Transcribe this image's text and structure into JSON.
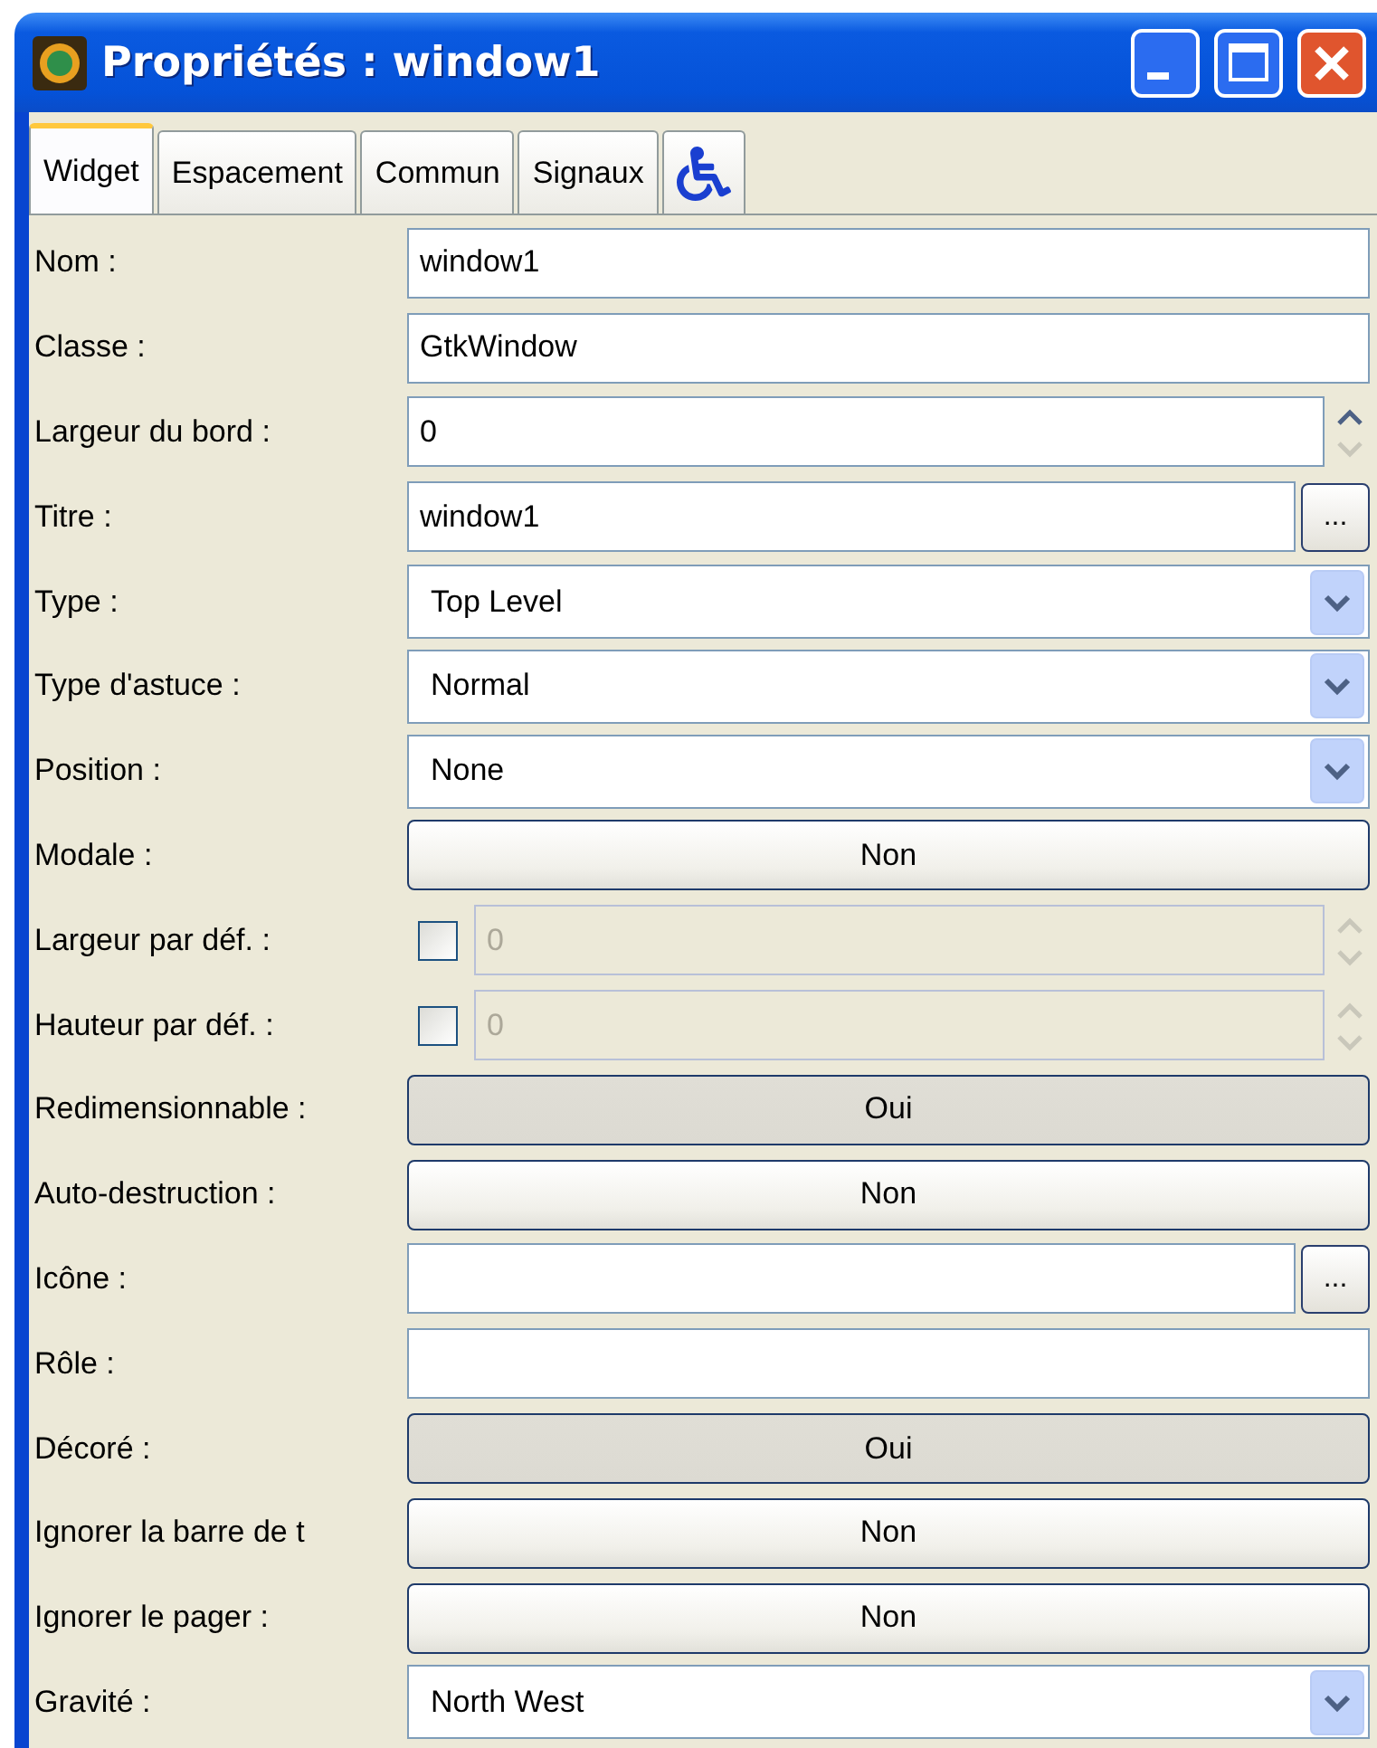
{
  "window": {
    "title": "Propriétés : window1"
  },
  "tabs": [
    {
      "kind": "text",
      "label": "Widget",
      "selected": true
    },
    {
      "kind": "text",
      "label": "Espacement",
      "selected": false
    },
    {
      "kind": "text",
      "label": "Commun",
      "selected": false
    },
    {
      "kind": "text",
      "label": "Signaux",
      "selected": false
    },
    {
      "kind": "icon",
      "selected": false
    }
  ],
  "properties": [
    {
      "kind": "entry",
      "label": "Nom :",
      "value": "window1"
    },
    {
      "kind": "entry",
      "label": "Classe :",
      "value": "GtkWindow"
    },
    {
      "kind": "spin",
      "label": "Largeur du bord :",
      "value": "0",
      "disabled": false
    },
    {
      "kind": "entry_button",
      "label": "Titre :",
      "value": "window1",
      "button": "..."
    },
    {
      "kind": "combo",
      "label": "Type :",
      "value": "Top Level"
    },
    {
      "kind": "combo",
      "label": "Type d'astuce :",
      "value": "Normal"
    },
    {
      "kind": "combo",
      "label": "Position :",
      "value": "None"
    },
    {
      "kind": "toggle",
      "label": "Modale :",
      "value": "Non",
      "pressed": false
    },
    {
      "kind": "check_spin",
      "label": "Largeur par déf. :",
      "checked": false,
      "value": "0",
      "disabled": true
    },
    {
      "kind": "check_spin",
      "label": "Hauteur par déf. :",
      "checked": false,
      "value": "0",
      "disabled": true
    },
    {
      "kind": "toggle",
      "label": "Redimensionnable :",
      "value": "Oui",
      "pressed": true
    },
    {
      "kind": "toggle",
      "label": "Auto-destruction :",
      "value": "Non",
      "pressed": false
    },
    {
      "kind": "entry_button",
      "label": "Icône :",
      "button": "..."
    },
    {
      "kind": "entry",
      "label": "Rôle :"
    },
    {
      "kind": "toggle",
      "label": "Décoré :",
      "value": "Oui",
      "pressed": true
    },
    {
      "kind": "toggle",
      "label": "Ignorer la barre de t",
      "value": "Non",
      "pressed": false
    },
    {
      "kind": "toggle",
      "label": "Ignorer le pager :",
      "value": "Non",
      "pressed": false
    },
    {
      "kind": "combo",
      "label": "Gravité :",
      "value": "North West"
    }
  ]
}
